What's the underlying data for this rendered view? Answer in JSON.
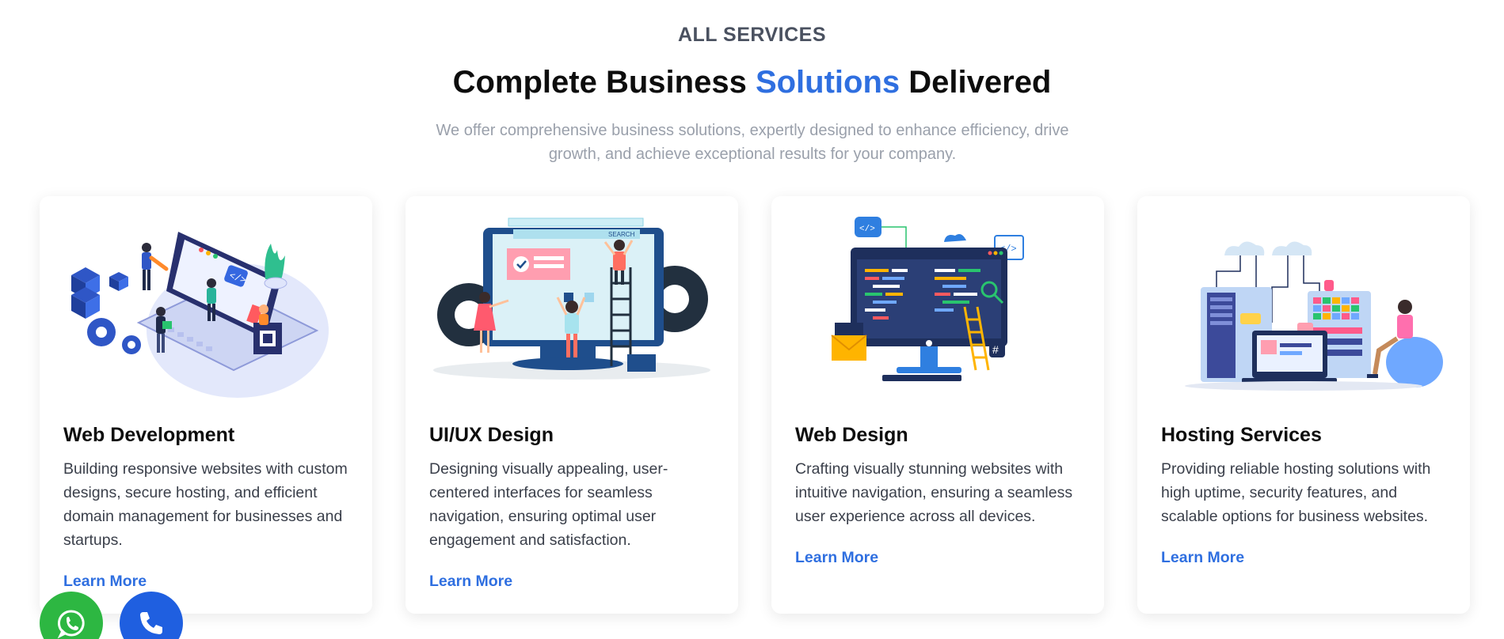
{
  "section": {
    "eyebrow": "ALL SERVICES",
    "title_part1": "Complete Business ",
    "title_accent": "Solutions",
    "title_part2": " Delivered",
    "subtitle": "We offer comprehensive business solutions, expertly designed to enhance efficiency, drive growth, and achieve exceptional results for your company."
  },
  "cards": [
    {
      "title": "Web Development",
      "description": "Building responsive websites with custom designs, secure hosting, and efficient domain management for businesses and startups.",
      "link": "Learn More",
      "illustration": "web-development-illustration"
    },
    {
      "title": "UI/UX Design",
      "description": "Designing visually appealing, user-centered interfaces for seamless navigation, ensuring optimal user engagement and satisfaction.",
      "link": "Learn More",
      "illustration": "ui-ux-design-illustration",
      "search_label": "SEARCH"
    },
    {
      "title": "Web Design",
      "description": "Crafting visually stunning websites with intuitive navigation, ensuring a seamless user experience across all devices.",
      "link": "Learn More",
      "illustration": "web-design-illustration"
    },
    {
      "title": "Hosting Services",
      "description": "Providing reliable hosting solutions with high uptime, security features, and scalable options for business websites.",
      "link": "Learn More",
      "illustration": "hosting-services-illustration"
    }
  ],
  "floating_buttons": {
    "whatsapp": "whatsapp-icon",
    "phone": "phone-icon"
  },
  "colors": {
    "accent": "#2f6fe0",
    "whatsapp": "#2db742",
    "phone": "#1f5fe0"
  }
}
